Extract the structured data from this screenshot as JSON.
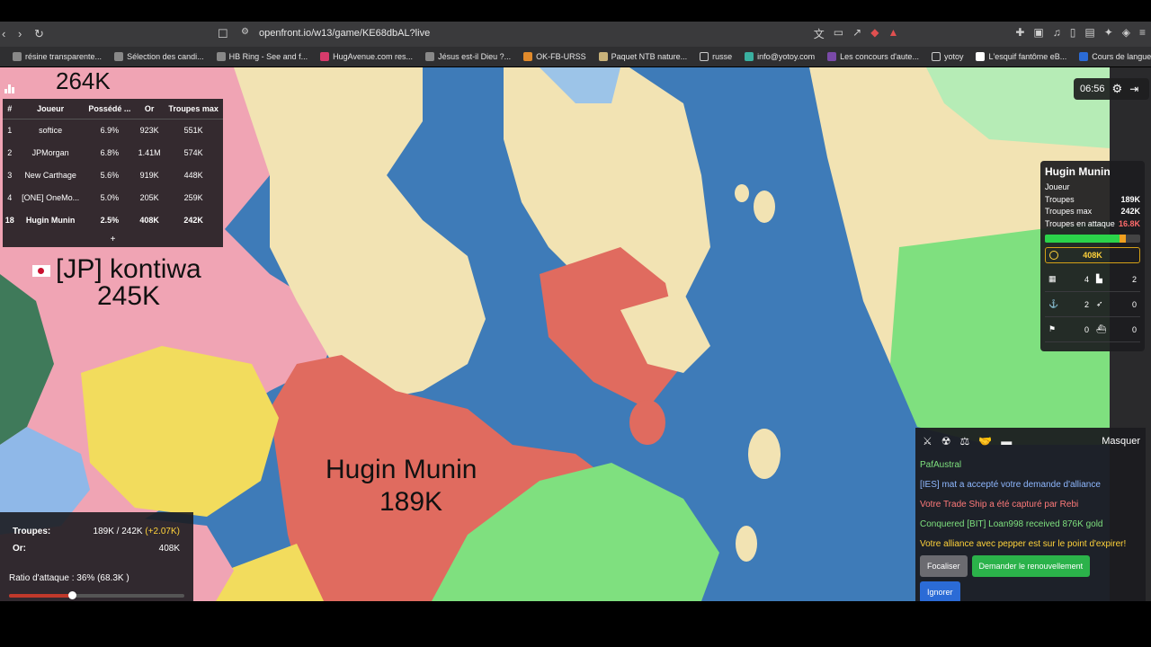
{
  "browser": {
    "url": "openfront.io/w13/game/KE68dbAL?live",
    "bookmarks": [
      "résine transparente...",
      "Sélection des candi...",
      "HB Ring - See and f...",
      "HugAvenue.com res...",
      "Jésus est-il Dieu ?...",
      "OK-FB-URSS",
      "Paquet NTB nature...",
      "russe",
      "info@yotoy.com",
      "Les concours d'aute...",
      "yotoy",
      "L'esquif fantôme eB...",
      "Cours de langues e..."
    ]
  },
  "leaderboard": {
    "headers": [
      "#",
      "Joueur",
      "Possédé ...",
      "Or",
      "Troupes max"
    ],
    "rows": [
      {
        "rank": "1",
        "player": "softice",
        "owned": "6.9%",
        "gold": "923K",
        "troops": "551K"
      },
      {
        "rank": "2",
        "player": "JPMorgan",
        "owned": "6.8%",
        "gold": "1.41M",
        "troops": "574K"
      },
      {
        "rank": "3",
        "player": "New Carthage",
        "owned": "5.6%",
        "gold": "919K",
        "troops": "448K"
      },
      {
        "rank": "4",
        "player": "[ONE] OneMo...",
        "owned": "5.0%",
        "gold": "205K",
        "troops": "259K"
      },
      {
        "rank": "18",
        "player": "Hugin Munin",
        "owned": "2.5%",
        "gold": "408K",
        "troops": "242K"
      }
    ],
    "expand": "+"
  },
  "timer": {
    "time": "06:56"
  },
  "map_labels": {
    "kontiwa_name": "[JP] kontiwa",
    "kontiwa_troops": "245K",
    "hugin_name": "Hugin Munin",
    "hugin_troops": "189K",
    "top_partial_troops": "264K"
  },
  "player_panel": {
    "name": "Hugin Munin",
    "type_label": "Joueur",
    "troops_label": "Troupes",
    "troops": "189K",
    "max_label": "Troupes max",
    "max": "242K",
    "attack_label": "Troupes en attaque",
    "attack": "16.8K",
    "troop_fill": 0.78,
    "attack_fill": 0.07,
    "gold": "408K",
    "stats": {
      "cities": "4",
      "factories": "2",
      "ports": "2",
      "missiles": "0",
      "sams": "0",
      "warships": "0"
    }
  },
  "chat": {
    "hide": "Masquer",
    "messages": [
      {
        "text": "PafAustral",
        "color": "#7ee07e"
      },
      {
        "text": "[IES] mat a accepté votre demande d'alliance",
        "color": "#8fb8ff"
      },
      {
        "text": "Votre Trade Ship a été capturé par Rebi",
        "color": "#ff7a7a"
      },
      {
        "text": "Conquered [BIT] Loan998 received 876K gold",
        "color": "#7ee07e"
      },
      {
        "text": "Votre alliance avec pepper est sur le point d'expirer!",
        "color": "#ffd23a"
      }
    ],
    "focus_btn": "Focaliser",
    "renew_btn": "Demander le renouvellement",
    "ignore_btn": "Ignorer"
  },
  "troops_panel": {
    "troops_label": "Troupes:",
    "troops_value": "189K / 242K",
    "troops_gain": "(+2.07K)",
    "gold_label": "Or:",
    "gold_value": "408K",
    "ratio_label": "Ratio d'attaque : 36% (68.3K )",
    "ratio": 0.36
  },
  "colors": {
    "ocean": "#3e7bb8",
    "hugin": "#e06b5f",
    "pink": "#f0a4b4",
    "yellow": "#f2dc5d",
    "green": "#7fe07f",
    "sand": "#f2e3b3"
  }
}
